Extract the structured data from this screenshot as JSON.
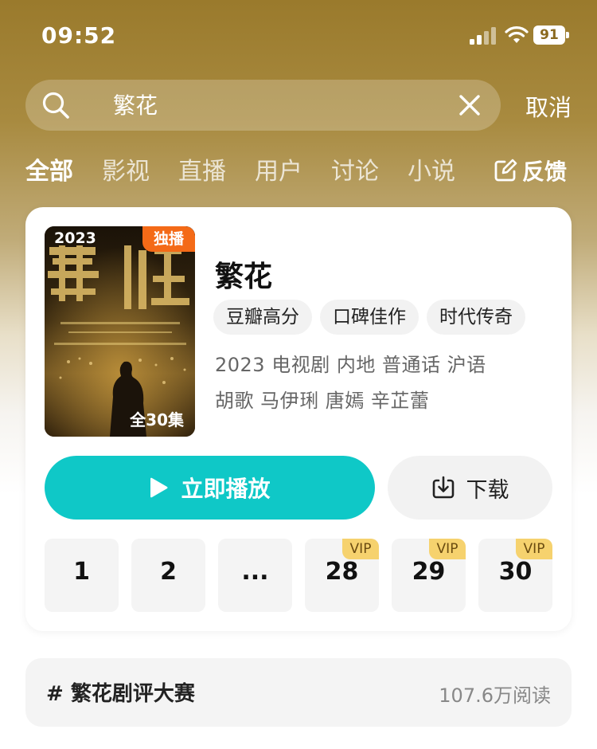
{
  "status_bar": {
    "time": "09:52",
    "battery": "91"
  },
  "search": {
    "query": "繁花",
    "cancel_label": "取消"
  },
  "tabs": [
    {
      "label": "全部",
      "active": true
    },
    {
      "label": "影视",
      "active": false
    },
    {
      "label": "直播",
      "active": false
    },
    {
      "label": "用户",
      "active": false
    },
    {
      "label": "讨论",
      "active": false
    },
    {
      "label": "小说",
      "active": false
    }
  ],
  "feedback_label": "反馈",
  "result": {
    "title": "繁花",
    "poster": {
      "year": "2023",
      "badge": "独播",
      "episodes_label": "全30集"
    },
    "tags": [
      "豆瓣高分",
      "口碑佳作",
      "时代传奇"
    ],
    "meta_line1": "2023 电视剧 内地 普通话 沪语",
    "meta_line2": "胡歌 马伊琍 唐嫣 辛芷蕾",
    "play_label": "立即播放",
    "download_label": "下载",
    "episodes": [
      {
        "label": "1",
        "vip": ""
      },
      {
        "label": "2",
        "vip": ""
      },
      {
        "label": "...",
        "vip": ""
      },
      {
        "label": "28",
        "vip": "VIP"
      },
      {
        "label": "29",
        "vip": "VIP"
      },
      {
        "label": "30",
        "vip": "VIP"
      }
    ]
  },
  "topic": {
    "title": "# 繁花剧评大赛",
    "reads": "107.6万阅读"
  },
  "colors": {
    "accent": "#0fc8c7",
    "badge": "#f46a17",
    "vip": "#f6d26e",
    "header": "#9a7a2c"
  }
}
